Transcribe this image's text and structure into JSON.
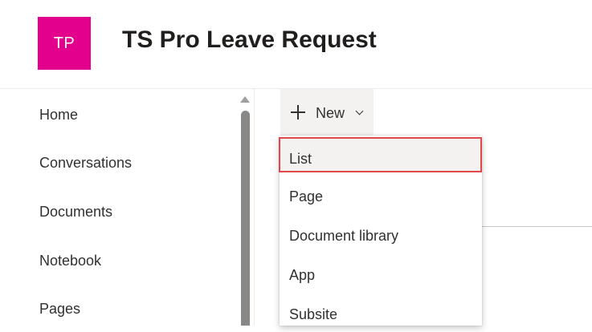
{
  "header": {
    "logo_initials": "TP",
    "logo_color": "#e3008c",
    "site_title": "TS Pro Leave Request"
  },
  "leftnav": {
    "items": [
      {
        "label": "Home"
      },
      {
        "label": "Conversations"
      },
      {
        "label": "Documents"
      },
      {
        "label": "Notebook"
      },
      {
        "label": "Pages"
      }
    ]
  },
  "command_bar": {
    "new_button": {
      "label": "New",
      "icon": "plus-icon",
      "dropdown_icon": "chevron-down-icon"
    }
  },
  "new_menu": {
    "highlight_color": "#e0484a",
    "items": [
      {
        "label": "List",
        "highlighted": true
      },
      {
        "label": "Page"
      },
      {
        "label": "Document library"
      },
      {
        "label": "App"
      },
      {
        "label": "Subsite"
      }
    ]
  }
}
